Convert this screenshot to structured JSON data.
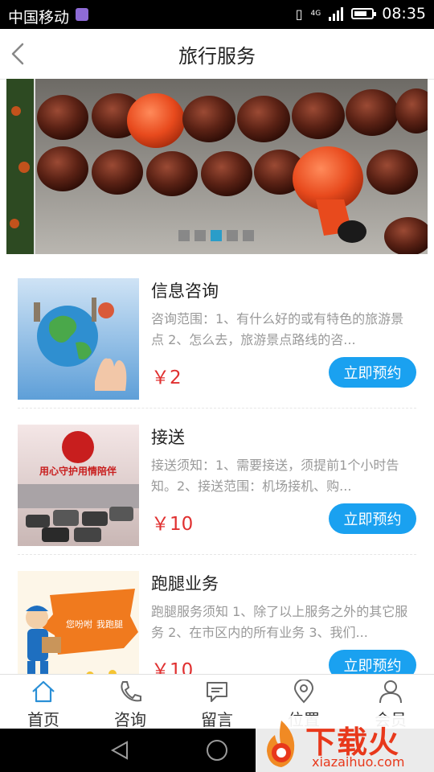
{
  "status_bar": {
    "carrier": "中国移动",
    "network": "4G",
    "time": "08:35"
  },
  "header": {
    "title": "旅行服务"
  },
  "banner": {
    "dot_count": 5,
    "active_dot": 2
  },
  "services": [
    {
      "name": "信息咨询",
      "desc": "咨询范围：1、有什么好的或有特色的旅游景点 2、怎么去，旅游景点路线的咨...",
      "price": "￥2",
      "button": "立即预约"
    },
    {
      "name": "接送",
      "desc": "接送须知：1、需要接送，须提前1个小时告知。2、接送范围：机场接机、购...",
      "price": "￥10",
      "button": "立即预约",
      "thumb_banner_text": "用心守护用情陪伴"
    },
    {
      "name": "跑腿业务",
      "desc": "跑腿服务须知 1、除了以上服务之外的其它服务 2、在市区内的所有业务 3、我们...",
      "price": "￥10",
      "button": "立即预约",
      "thumb_text_1": "您吩咐",
      "thumb_text_2": "我跑腿"
    }
  ],
  "tabs": [
    {
      "label": "首页",
      "icon": "home-icon",
      "active": true
    },
    {
      "label": "咨询",
      "icon": "phone-icon"
    },
    {
      "label": "留言",
      "icon": "message-icon"
    },
    {
      "label": "位置",
      "icon": "location-icon"
    },
    {
      "label": "会员",
      "icon": "user-icon"
    }
  ],
  "watermark": {
    "text": "下载火",
    "url": "xiazaihuo.com"
  },
  "colors": {
    "accent": "#1aa1f0",
    "price": "#e03030",
    "tab_active": "#2a8fd6"
  }
}
